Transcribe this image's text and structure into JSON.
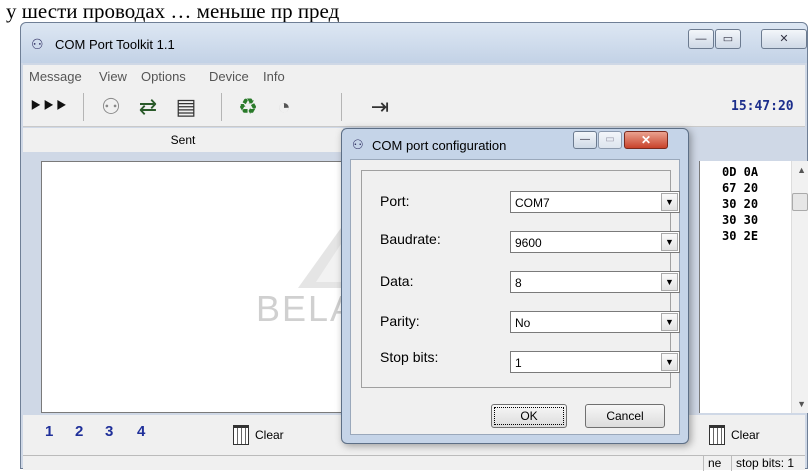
{
  "background": {
    "text_fragment": "у шести проводах … меньше пр пред"
  },
  "main_window": {
    "title": "COM Port Toolkit 1.1",
    "min_label": "—",
    "max_label": "▭",
    "close_label": "✕"
  },
  "menu": [
    "Message",
    "View",
    "Options",
    "Device",
    "Info"
  ],
  "toolbar": {
    "clock": "15:47:20"
  },
  "sent_panel": {
    "header": "Sent"
  },
  "received_panel": {
    "hex_lines": [
      "0D 0A",
      "67 20",
      "30 20",
      "30 30",
      "30 2E"
    ]
  },
  "bottom": {
    "clear_left": "Clear",
    "clear_right": "Clear",
    "send_icons": [
      "1",
      "2",
      "3",
      "4"
    ]
  },
  "status_bar": {
    "partial": "ne",
    "stop_bits": "stop bits: 1"
  },
  "dialog": {
    "title": "COM port configuration",
    "fields": [
      {
        "label": "Port:",
        "value": "COM7"
      },
      {
        "label": "Baudrate:",
        "value": "9600"
      },
      {
        "label": "Data:",
        "value": "8"
      },
      {
        "label": "Parity:",
        "value": "No"
      },
      {
        "label": "Stop bits:",
        "value": "1"
      }
    ],
    "ok": "OK",
    "cancel": "Cancel"
  },
  "watermark": {
    "text": "BELAPEX"
  }
}
